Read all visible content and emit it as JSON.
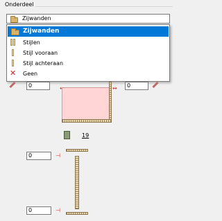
{
  "group": {
    "label": "Onderdeel"
  },
  "combo": {
    "value": "Zijwanden",
    "icon": "folder-icon"
  },
  "dropdown": {
    "items": [
      {
        "label": "Zijwanden",
        "icon": "folder-icon",
        "selected": true
      },
      {
        "label": "Stijlen",
        "icon": "double-side-icon",
        "selected": false
      },
      {
        "label": "Stijl vooraan",
        "icon": "side-front-icon",
        "selected": false
      },
      {
        "label": "Stijl achteraan",
        "icon": "side-back-icon",
        "selected": false
      },
      {
        "label": "Geen",
        "icon": "red-x-icon",
        "selected": false
      }
    ]
  },
  "fields": {
    "top_left_value": "0",
    "top_right_value": "0",
    "mid_value": "0",
    "bottom_value": "0"
  },
  "count_label": "19",
  "colors": {
    "selection": "#0078d7",
    "cabinet_fill": "#ffd5d5",
    "dimension": "#e02020"
  }
}
